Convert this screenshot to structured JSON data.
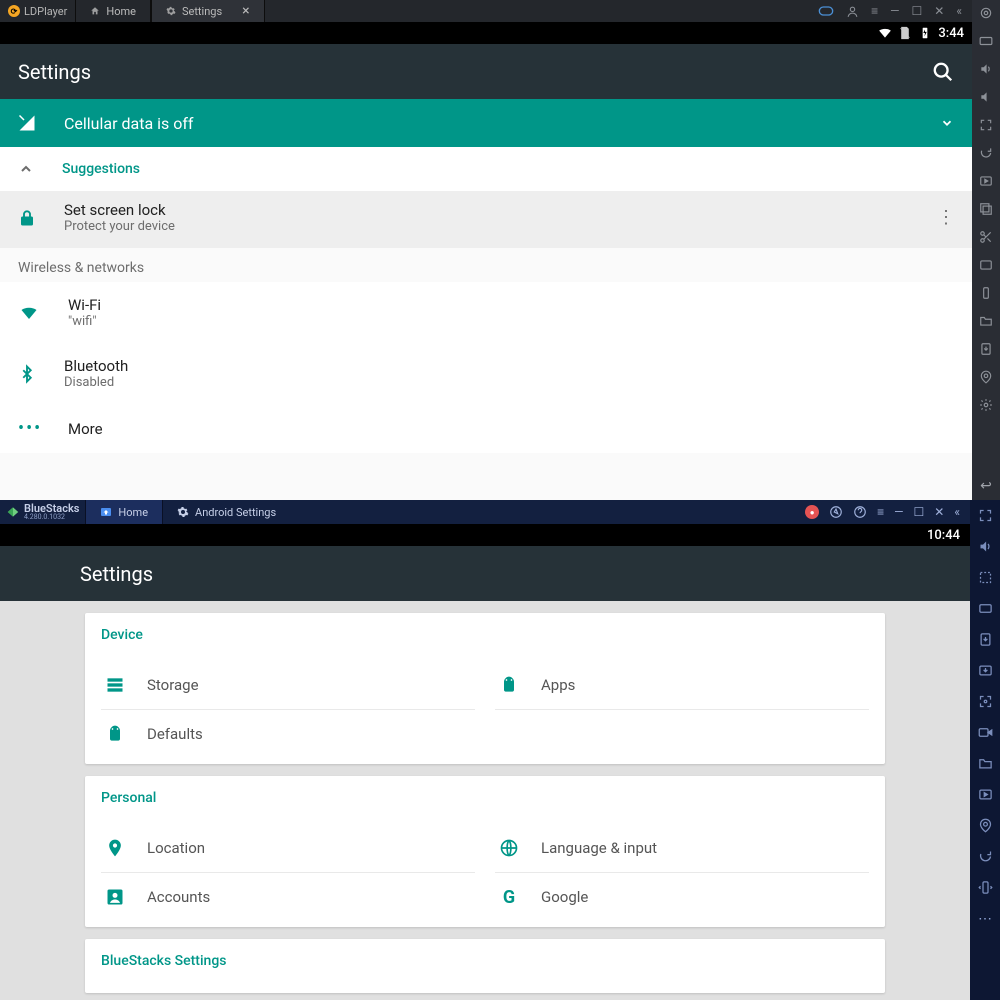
{
  "ldplayer": {
    "brand": "LDPlayer",
    "tabs": [
      {
        "label": "Home"
      },
      {
        "label": "Settings",
        "active": true
      }
    ],
    "status": {
      "time": "3:44"
    },
    "toolbar_title": "Settings",
    "banner": "Cellular data is off",
    "suggestions_label": "Suggestions",
    "lock": {
      "title": "Set screen lock",
      "sub": "Protect your device"
    },
    "section_wireless": "Wireless & networks",
    "items": {
      "wifi": {
        "title": "Wi-Fi",
        "sub": "\"wifi\""
      },
      "bluetooth": {
        "title": "Bluetooth",
        "sub": "Disabled"
      },
      "more": {
        "title": "More"
      }
    }
  },
  "bluestacks": {
    "brand": "BlueStacks",
    "version": "4.280.0.1032",
    "tabs": [
      {
        "label": "Home"
      },
      {
        "label": "Android Settings",
        "active": true
      }
    ],
    "status": {
      "time": "10:44"
    },
    "toolbar_title": "Settings",
    "cards": {
      "device": {
        "head": "Device",
        "storage": "Storage",
        "apps": "Apps",
        "defaults": "Defaults"
      },
      "personal": {
        "head": "Personal",
        "location": "Location",
        "language": "Language & input",
        "accounts": "Accounts",
        "google": "Google"
      },
      "bs_settings": {
        "head": "BlueStacks Settings"
      }
    }
  }
}
